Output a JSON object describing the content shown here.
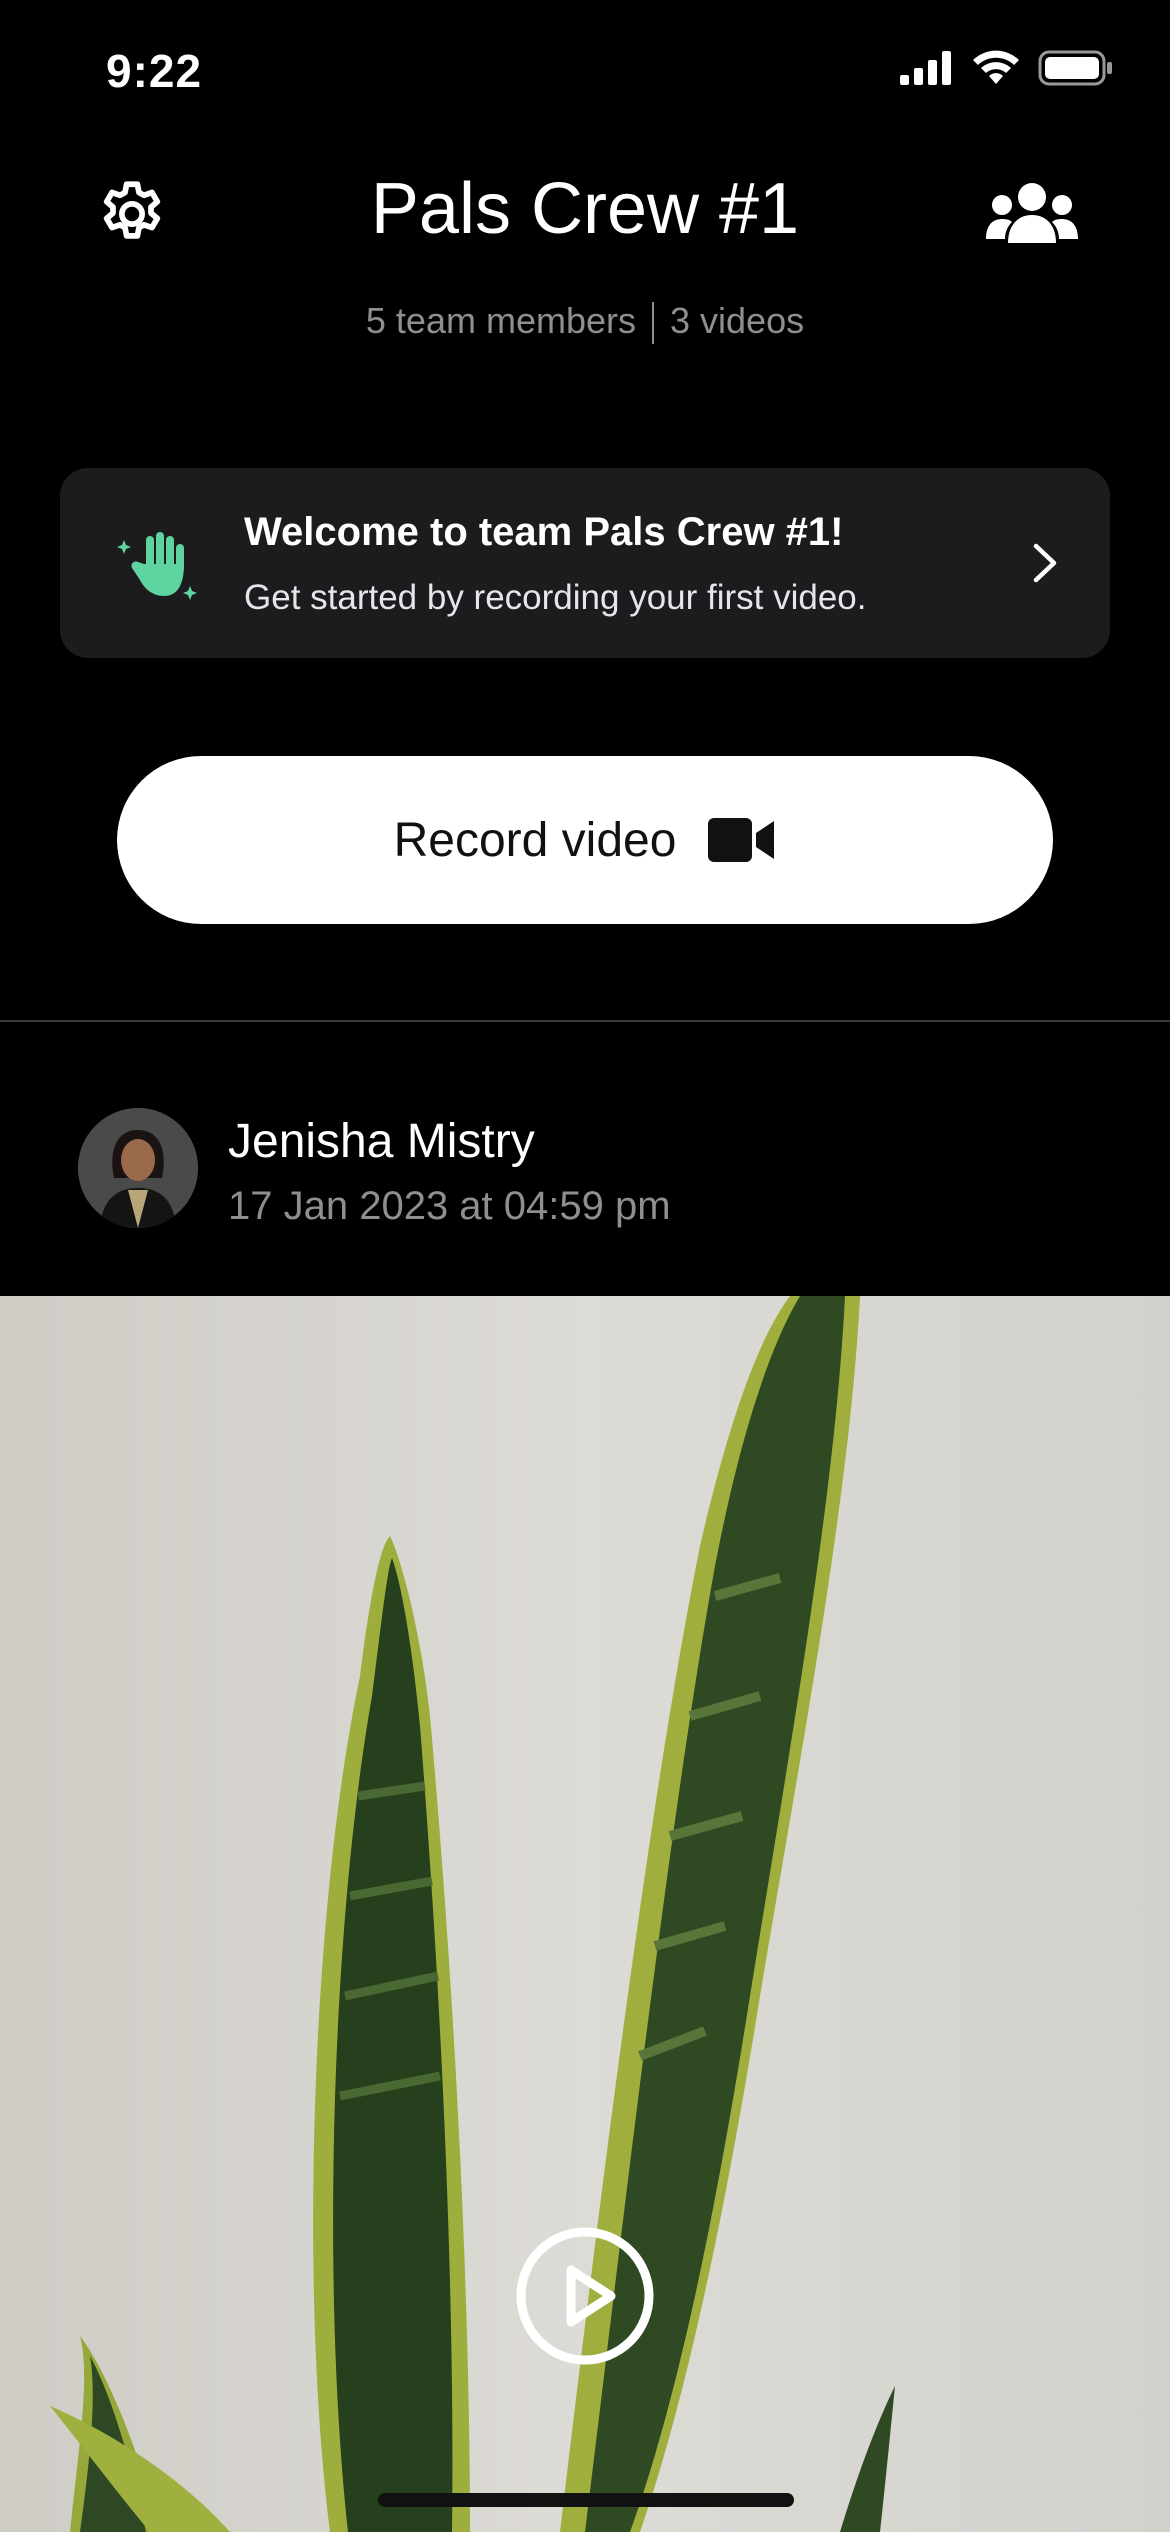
{
  "status_bar": {
    "time": "9:22",
    "icons": [
      "cellular-signal-icon",
      "wifi-icon",
      "battery-icon"
    ]
  },
  "header": {
    "title": "Pals Crew #1",
    "members_text": "5 team members",
    "videos_text": "3 videos",
    "left_icon": "gear-icon",
    "right_icon": "team-members-icon"
  },
  "welcome_card": {
    "icon": "waving-hand-sparkle-icon",
    "title": "Welcome to team Pals Crew #1!",
    "text": "Get started by recording your first video.",
    "accent_color": "#5fd4a0"
  },
  "record_button": {
    "label": "Record video",
    "icon": "video-camera-icon"
  },
  "post": {
    "author": "Jenisha Mistry",
    "date": "17 Jan 2023 at 04:59 pm",
    "video_icon": "play-icon"
  }
}
